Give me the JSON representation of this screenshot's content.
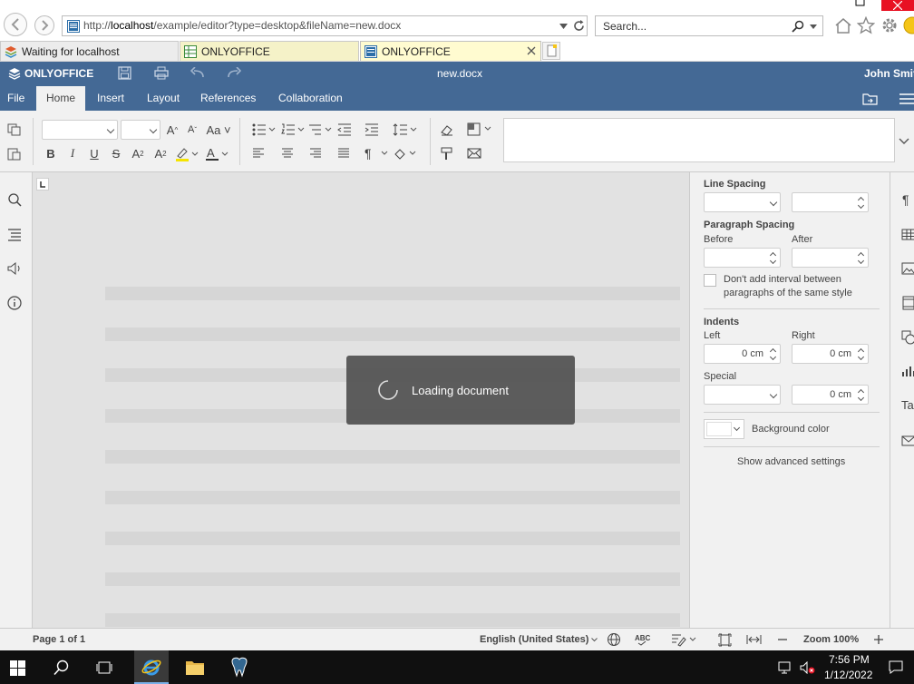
{
  "browser": {
    "address": "http://localhost/example/editor?type=desktop&fileName=new.docx",
    "address_host": "localhost",
    "address_prefix": "http://",
    "address_suffix": "/example/editor?type=desktop&fileName=new.docx",
    "search_placeholder": "Search...",
    "tabs": [
      {
        "label": "Waiting for localhost"
      },
      {
        "label": "ONLYOFFICE"
      },
      {
        "label": "ONLYOFFICE"
      }
    ]
  },
  "editor": {
    "brand": "ONLYOFFICE",
    "doc_title": "new.docx",
    "user": "John Smith",
    "menu": [
      "File",
      "Home",
      "Insert",
      "Layout",
      "References",
      "Collaboration"
    ]
  },
  "loading": {
    "text": "Loading document"
  },
  "settings": {
    "line_spacing": "Line Spacing",
    "paragraph_spacing": "Paragraph Spacing",
    "before": "Before",
    "after": "After",
    "checkbox_text_1": "Don't add interval between",
    "checkbox_text_2": "paragraphs of the same style",
    "indents": "Indents",
    "left": "Left",
    "right": "Right",
    "left_value": "0 cm",
    "right_value": "0 cm",
    "special": "Special",
    "special_value": "0 cm",
    "background_color": "Background color",
    "advanced": "Show advanced settings"
  },
  "status": {
    "page": "Page 1 of 1",
    "language": "English (United States)",
    "zoom": "Zoom 100%"
  },
  "taskbar": {
    "time": "7:56 PM",
    "date": "1/12/2022"
  },
  "colors": {
    "header_blue": "#446995",
    "toolbar_bg": "#f1f1f1",
    "doc_bg": "#e2e2e2"
  }
}
